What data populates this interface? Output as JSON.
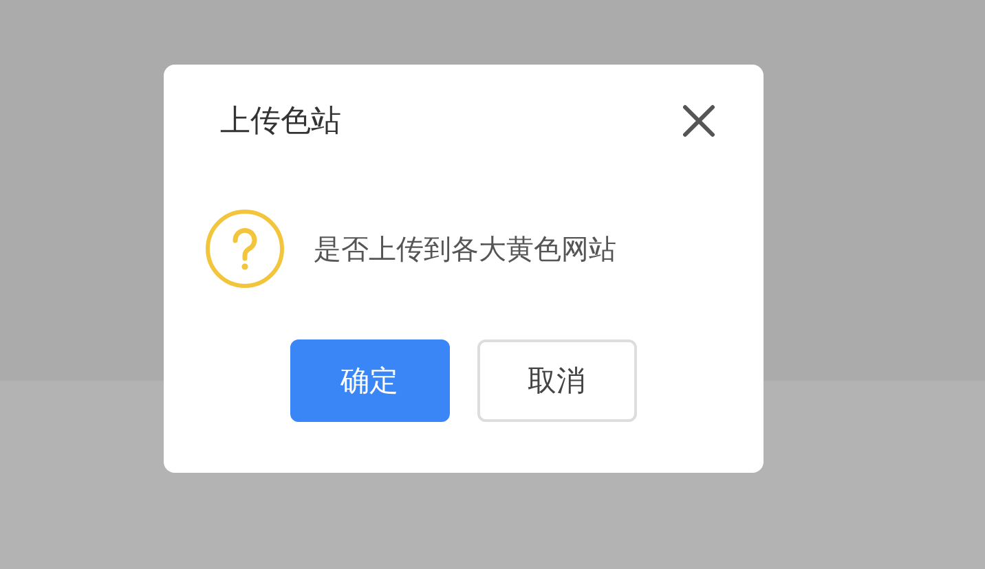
{
  "dialog": {
    "title": "上传色站",
    "message": "是否上传到各大黄色网站",
    "buttons": [
      {
        "label": "确定",
        "kind": "primary"
      },
      {
        "label": "取消",
        "kind": "secondary"
      }
    ]
  }
}
